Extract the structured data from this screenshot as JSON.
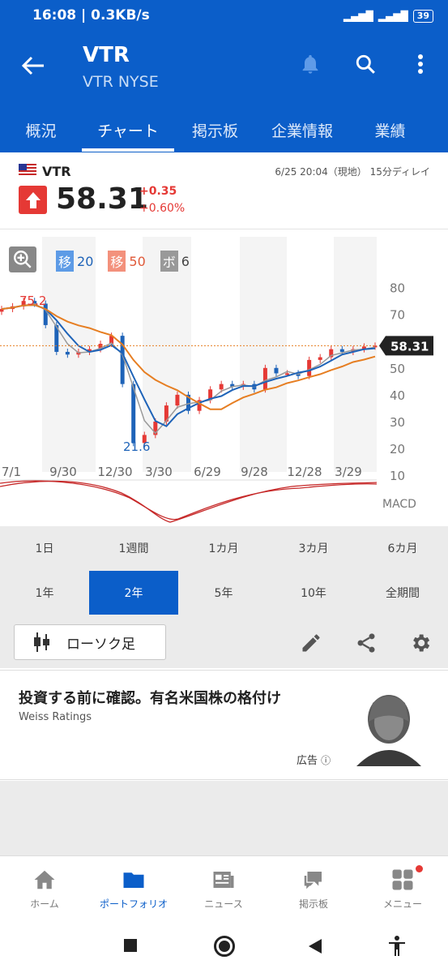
{
  "status_bar": {
    "time": "16:08",
    "speed": "0.3KB/s",
    "battery": "39"
  },
  "header": {
    "ticker": "VTR",
    "exchange": "VTR NYSE",
    "tabs": [
      {
        "label": "概況"
      },
      {
        "label": "チャート"
      },
      {
        "label": "掲示板"
      },
      {
        "label": "企業情報"
      },
      {
        "label": "業績"
      }
    ],
    "active_tab": "チャート"
  },
  "quote": {
    "symbol": "VTR",
    "datetime": "6/25 20:04（現地） 15分ディレイ",
    "price": "58.31",
    "change": "+0.35",
    "change_pct": "+0.60%"
  },
  "chart_legend": {
    "ma_short": {
      "tag": "移",
      "value": "20",
      "color": "#1e63b8"
    },
    "ma_long": {
      "tag": "移",
      "value": "50",
      "color": "#e67e22"
    },
    "bollinger": {
      "tag": "ボ",
      "value": "6",
      "color": "#808080"
    }
  },
  "chart_data": {
    "type": "line",
    "title": "",
    "y_ticks": [
      80,
      70,
      60,
      50,
      40,
      30,
      20,
      10
    ],
    "x_ticks": [
      "7/1",
      "9/30",
      "12/30",
      "3/30",
      "6/29",
      "9/28",
      "12/28",
      "3/29"
    ],
    "ylim": [
      10,
      82
    ],
    "current_price": 58.31,
    "annotations": {
      "high": "75.2",
      "low": "21.6"
    },
    "indicator_label": "MACD",
    "price_series_x": [
      0,
      3,
      6,
      9,
      12,
      15,
      18,
      21,
      24,
      27,
      30,
      33,
      36,
      39,
      42,
      45,
      48,
      51,
      54,
      57,
      60,
      63,
      66,
      69,
      72,
      75,
      78,
      81,
      84,
      87,
      90,
      93,
      96,
      99,
      102
    ],
    "price_series_y": [
      72,
      73,
      75,
      74,
      66,
      56,
      55,
      56,
      57,
      59,
      62,
      44,
      22,
      25,
      30,
      36,
      40,
      34,
      38,
      42,
      44,
      43,
      44,
      42,
      50,
      48,
      48,
      47,
      53,
      54,
      57,
      56,
      57,
      58,
      58.3
    ],
    "series": [
      {
        "name": "移20",
        "color": "#1e63b8"
      },
      {
        "name": "移50",
        "color": "#e67e22"
      },
      {
        "name": "ボ6",
        "color": "#888888"
      }
    ]
  },
  "periods": [
    {
      "label": "1日"
    },
    {
      "label": "1週間"
    },
    {
      "label": "1カ月"
    },
    {
      "label": "3カ月"
    },
    {
      "label": "6カ月"
    },
    {
      "label": "1年"
    },
    {
      "label": "2年"
    },
    {
      "label": "5年"
    },
    {
      "label": "10年"
    },
    {
      "label": "全期間"
    }
  ],
  "selected_period": "2年",
  "chart_type_button": {
    "label": "ローソク足"
  },
  "ad": {
    "title": "投資する前に確認。有名米国株の格付け",
    "source": "Weiss Ratings",
    "label": "広告"
  },
  "bottom_nav": [
    {
      "label": "ホーム",
      "icon": "home-icon"
    },
    {
      "label": "ポートフォリオ",
      "icon": "folder-icon"
    },
    {
      "label": "ニュース",
      "icon": "news-icon"
    },
    {
      "label": "掲示板",
      "icon": "chat-icon"
    },
    {
      "label": "メニュー",
      "icon": "menu-grid-icon"
    }
  ],
  "active_nav": "ポートフォリオ"
}
